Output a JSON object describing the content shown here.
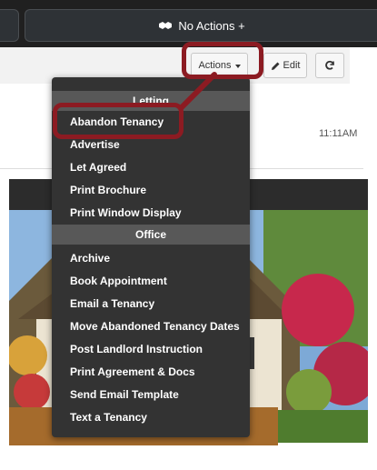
{
  "topbar": {
    "no_actions_label": "No Actions +"
  },
  "toolbar": {
    "actions_label": "Actions",
    "edit_label": "Edit"
  },
  "content": {
    "timestamp": "11:11AM"
  },
  "menu": {
    "group_letting": "Letting",
    "letting_items": [
      "Abandon Tenancy",
      "Advertise",
      "Let Agreed",
      "Print Brochure",
      "Print Window Display"
    ],
    "group_office": "Office",
    "office_items": [
      "Archive",
      "Book Appointment",
      "Email a Tenancy",
      "Move Abandoned Tenancy Dates",
      "Post Landlord Instruction",
      "Print Agreement & Docs",
      "Send Email Template",
      "Text a Tenancy"
    ]
  },
  "colors": {
    "annotation": "#8c1b22",
    "menu_bg": "#333333",
    "menu_header_bg": "#585858"
  }
}
